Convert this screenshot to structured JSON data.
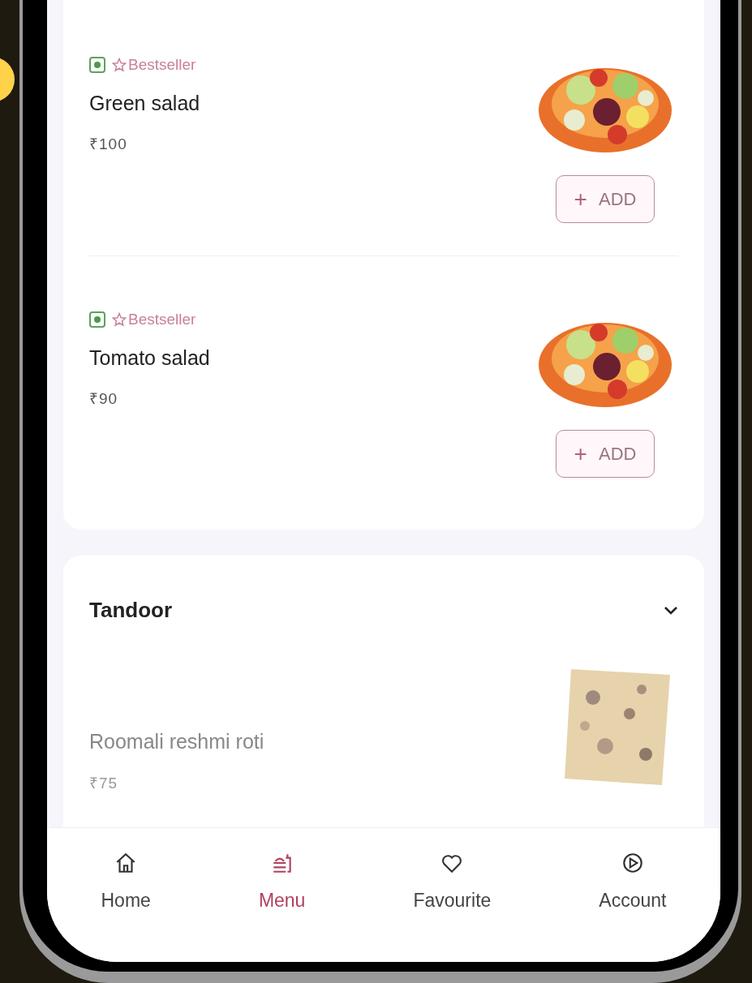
{
  "sections": [
    {
      "items": [
        {
          "veg": true,
          "bestseller": true,
          "badge": "Bestseller",
          "name": "Green salad",
          "price": "₹100",
          "available": true,
          "button": {
            "icon": "+",
            "label": "ADD"
          }
        },
        {
          "veg": true,
          "bestseller": true,
          "badge": "Bestseller",
          "name": "Tomato salad",
          "price": "₹90",
          "available": true,
          "button": {
            "icon": "+",
            "label": "ADD"
          }
        }
      ]
    },
    {
      "title": "Tandoor",
      "expanded": true,
      "items": [
        {
          "veg": false,
          "bestseller": false,
          "name": "Roomali reshmi roti",
          "price": "₹75",
          "available": false
        }
      ]
    }
  ],
  "nav": [
    {
      "label": "Home",
      "selected": false
    },
    {
      "label": "Menu",
      "selected": true
    },
    {
      "label": "Favourite",
      "selected": false
    },
    {
      "label": "Account",
      "selected": false
    }
  ]
}
